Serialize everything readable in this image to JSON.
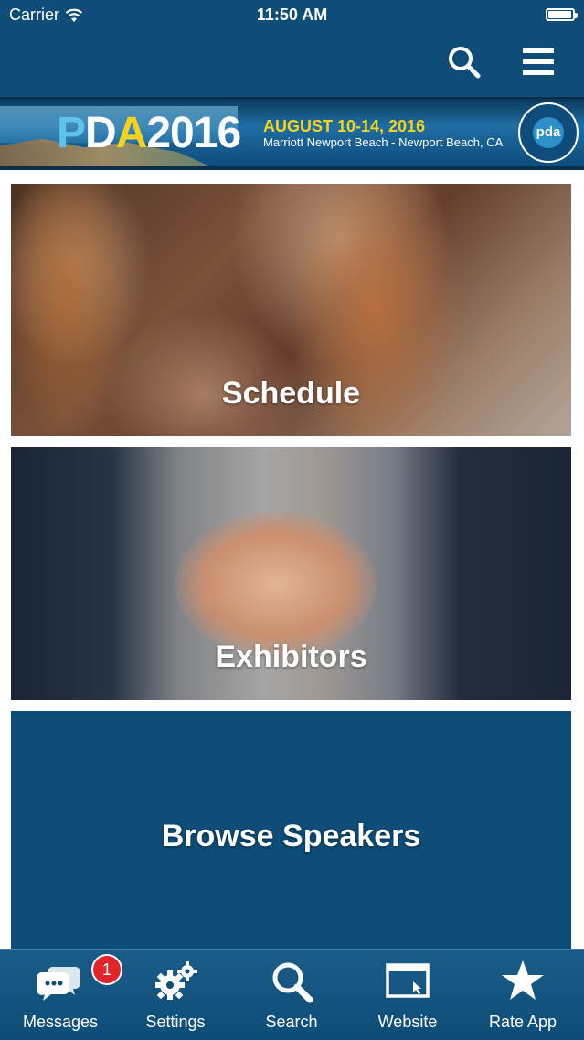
{
  "status_bar": {
    "carrier": "Carrier",
    "time": "11:50 AM",
    "battery_level": 0.95
  },
  "nav": {
    "search_icon": "search-icon",
    "menu_icon": "hamburger-menu-icon"
  },
  "banner": {
    "title_parts": [
      "P",
      "D",
      "A",
      "2016"
    ],
    "dates": "AUGUST 10-14, 2016",
    "venue": "Marriott Newport Beach - Newport Beach, CA",
    "seal_text": "pda",
    "colors": {
      "p": "#5fc2ea",
      "a": "#f4d21f",
      "dates": "#f4d21f"
    }
  },
  "tiles": [
    {
      "label": "Schedule"
    },
    {
      "label": "Exhibitors"
    },
    {
      "label": "Browse Speakers"
    }
  ],
  "tabbar": {
    "items": [
      {
        "label": "Messages",
        "icon": "messages-icon",
        "badge": "1"
      },
      {
        "label": "Settings",
        "icon": "settings-icon"
      },
      {
        "label": "Search",
        "icon": "search-icon"
      },
      {
        "label": "Website",
        "icon": "website-icon"
      },
      {
        "label": "Rate App",
        "icon": "star-icon"
      }
    ]
  },
  "colors": {
    "primary": "#0d4d78",
    "badge": "#e2252b"
  }
}
